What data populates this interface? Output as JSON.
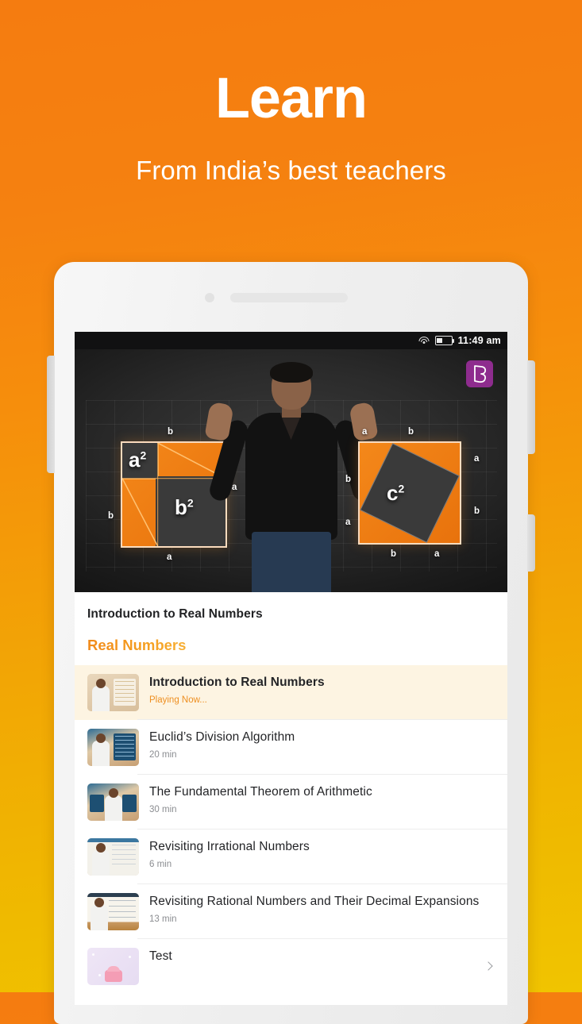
{
  "hero": {
    "title": "Learn",
    "subtitle": "From India’s best teachers"
  },
  "theme": {
    "bg_top": "#F57C10",
    "bg_bottom": "#F0C400",
    "accent_orange": "#F0861A",
    "accent_amber": "#F8B53C",
    "active_row_bg": "#FDF4E2",
    "logo_purple": "#8E2C8E"
  },
  "phone": {
    "statusbar": {
      "time": "11:49 am",
      "wifi_icon": "wifi-icon",
      "battery_icon": "battery-icon"
    },
    "hardware": {
      "camera": "front-camera",
      "speaker": "earpiece-speaker",
      "left_volume_button": "volume-rocker",
      "right_volume_button": "volume-button",
      "right_power_button": "power-button"
    }
  },
  "video": {
    "brand_logo": "byjus-b-logo",
    "equation_labels": {
      "left_big": "a",
      "left_big_exp": "2",
      "left_big2": "b",
      "left_big2_exp": "2",
      "right_big": "c",
      "right_big_exp": "2",
      "sides": [
        "a",
        "b",
        "a",
        "b",
        "a",
        "b",
        "a",
        "b",
        "a",
        "b",
        "a",
        "b"
      ]
    },
    "title": "Introduction to Real Numbers"
  },
  "section": {
    "heading": "Real Numbers"
  },
  "lessons": [
    {
      "title": "Introduction to Real Numbers",
      "meta": "Playing Now...",
      "active": true,
      "thumb": "lesson-thumbnail",
      "chevron": false
    },
    {
      "title": "Euclid’s Division Algorithm",
      "meta": "20 min",
      "active": false,
      "thumb": "lesson-thumbnail",
      "chevron": false
    },
    {
      "title": "The Fundamental Theorem of Arithmetic",
      "meta": "30 min",
      "active": false,
      "thumb": "lesson-thumbnail",
      "chevron": false
    },
    {
      "title": "Revisiting Irrational Numbers",
      "meta": "6 min",
      "active": false,
      "thumb": "lesson-thumbnail",
      "chevron": false
    },
    {
      "title": "Revisiting Rational Numbers and Their Decimal Expansions",
      "meta": "13 min",
      "active": false,
      "thumb": "lesson-thumbnail",
      "chevron": false
    },
    {
      "title": "Test",
      "meta": "",
      "active": false,
      "thumb": "test-thumbnail",
      "chevron": true
    }
  ]
}
